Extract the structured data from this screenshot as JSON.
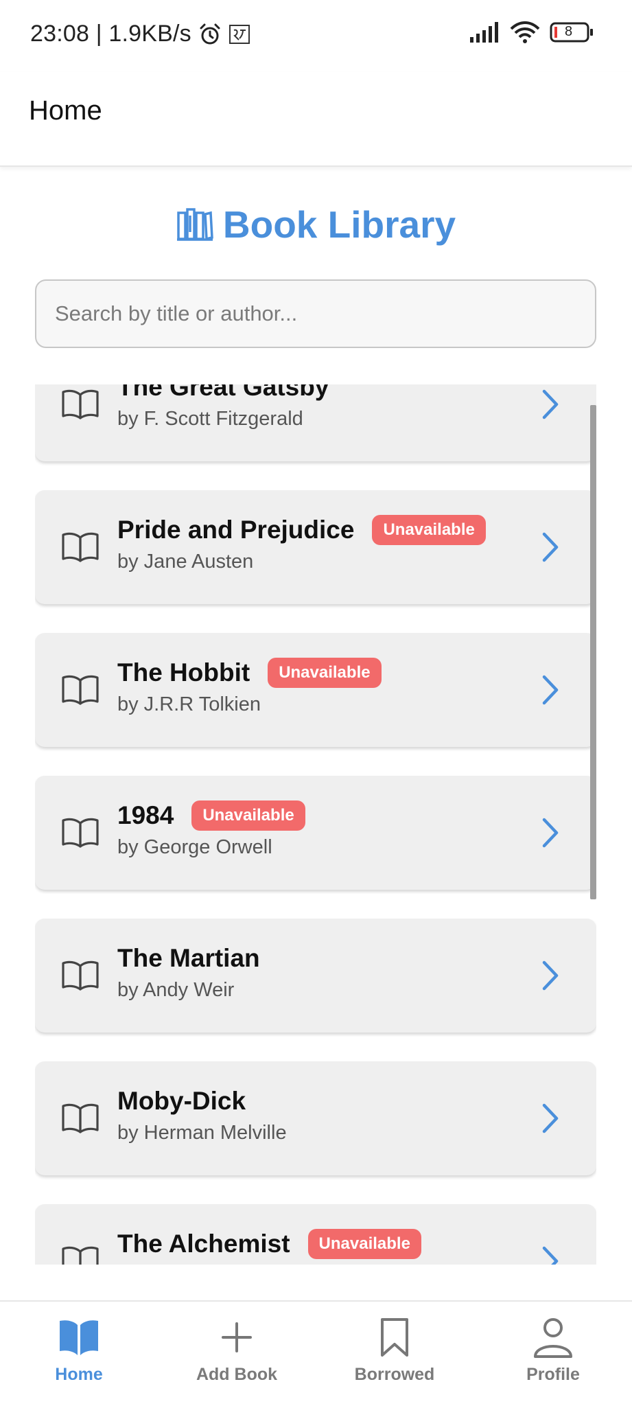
{
  "status_bar": {
    "time_speed": "23:08 | 1.9KB/s",
    "battery_level": "8"
  },
  "header": {
    "title": "Home"
  },
  "library": {
    "title": "Book Library"
  },
  "search": {
    "placeholder": "Search by title or author..."
  },
  "books": [
    {
      "title": "The Great Gatsby",
      "author": "by F. Scott Fitzgerald",
      "badge": ""
    },
    {
      "title": "Pride and Prejudice",
      "author": "by Jane Austen",
      "badge": "Unavailable"
    },
    {
      "title": "The Hobbit",
      "author": "by J.R.R Tolkien",
      "badge": "Unavailable"
    },
    {
      "title": "1984",
      "author": "by George Orwell",
      "badge": "Unavailable"
    },
    {
      "title": "The Martian",
      "author": "by Andy Weir",
      "badge": ""
    },
    {
      "title": "Moby-Dick",
      "author": "by Herman Melville",
      "badge": ""
    },
    {
      "title": "The Alchemist",
      "author": "",
      "badge": "Unavailable"
    }
  ],
  "nav": {
    "home": "Home",
    "add_book": "Add Book",
    "borrowed": "Borrowed",
    "profile": "Profile"
  },
  "colors": {
    "accent": "#4a8fdb",
    "badge": "#f26a6a",
    "card": "#efefef"
  }
}
